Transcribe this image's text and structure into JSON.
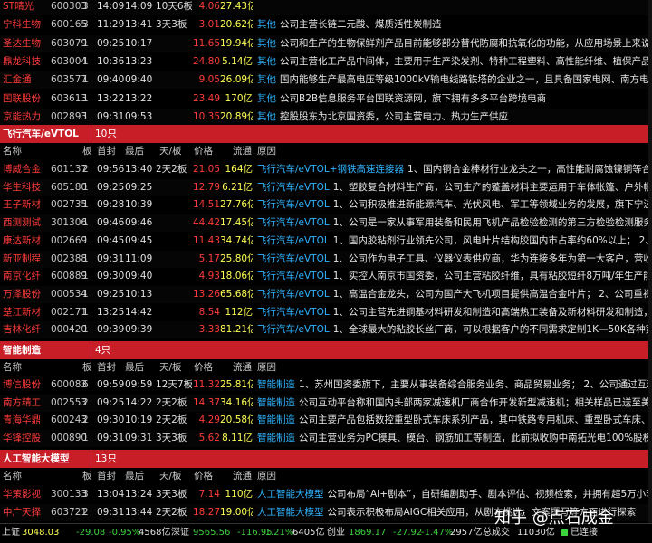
{
  "columns": {
    "name": "名称",
    "board": "板",
    "first": "首封",
    "last": "最后",
    "days": "天/板",
    "price": "价格",
    "flow": "流通",
    "reason": "原因"
  },
  "block1": {
    "rows": [
      {
        "name": "ST晴光",
        "code": "600303",
        "board": "3",
        "first": "14:09",
        "last": "14:09",
        "days": "10天6板",
        "price": "4.06",
        "flow": "27.43亿",
        "tag": "",
        "text": ""
      },
      {
        "name": "宁科生物",
        "code": "600165",
        "board": "3",
        "first": "11:29",
        "last": "13:41",
        "days": "3天3板",
        "price": "3.01",
        "flow": "20.62亿",
        "tag": "其他",
        "text": "公司主营长链二元酸、煤质活性炭制造"
      },
      {
        "name": "圣达生物",
        "code": "603079",
        "board": "1",
        "first": "09:25",
        "last": "10:17",
        "days": "",
        "price": "11.65",
        "flow": "19.94亿",
        "tag": "其他",
        "text": "公司和生产的生物保鲜剂产品目前能够部分替代防腐和抗氧化的功能，从应用场景上来说，能够提"
      },
      {
        "name": "鼎龙科技",
        "code": "603004",
        "board": "1",
        "first": "10:36",
        "last": "13:23",
        "days": "",
        "price": "24.80",
        "flow": "5.14亿",
        "tag": "其他",
        "text": "公司主营化工产品中间体，主要用于生产染发剂、特种工程塑料、高性能纤维、植保产品等，在化"
      },
      {
        "name": "汇金通",
        "code": "603577",
        "board": "1",
        "first": "09:40",
        "last": "09:40",
        "days": "",
        "price": "9.05",
        "flow": "26.09亿",
        "tag": "其他",
        "text": "国内能够生产最高电压等级1000kV输电线路铁塔的企业之一，且具备国家电网、南方电网等公"
      },
      {
        "name": "国联股份",
        "code": "603613",
        "board": "1",
        "first": "13:22",
        "last": "13:22",
        "days": "",
        "price": "23.49",
        "flow": "170亿",
        "tag": "其他",
        "text": "公司B2B信息服务平台国联资源网，旗下拥有多多平台跨境电商"
      },
      {
        "name": "京能热力",
        "code": "002893",
        "board": "1",
        "first": "09:31",
        "last": "09:53",
        "days": "",
        "price": "10.35",
        "flow": "20.89亿",
        "tag": "其他",
        "text": "控股股东为北京国资委，公司主营电力、热力生产供应"
      }
    ]
  },
  "section_flying": {
    "name": "飞行汽车/eVTOL",
    "count": "10只"
  },
  "block2": {
    "rows": [
      {
        "name": "博威合金",
        "code": "601137",
        "board": "2",
        "first": "09:56",
        "last": "13:40",
        "days": "2天2板",
        "price": "21.05",
        "flow": "164亿",
        "tag": "飞行汽车/eVTOL+钢铁高速连接器",
        "text": "1、国内铜合金棒材行业龙头之一，高性能耐腐蚀镍铜等合金材料"
      },
      {
        "name": "华生科技",
        "code": "605180",
        "board": "1",
        "first": "09:25",
        "last": "09:25",
        "days": "",
        "price": "12.79",
        "flow": "6.21亿",
        "tag": "飞行汽车/eVTOL",
        "text": "1、塑胶复合材料生产商，公司生产的蓬盖材料主要运用于车体帐篷、户外帐篷、箱包"
      },
      {
        "name": "王子新材",
        "code": "002735",
        "board": "1",
        "first": "09:28",
        "last": "10:39",
        "days": "",
        "price": "14.51",
        "flow": "27.76亿",
        "tag": "飞行汽车/eVTOL",
        "text": "1、公司积极推进新能源汽车、光伏风电、军工等领域业务的发展，旗下宁波新容与"
      },
      {
        "name": "西测测试",
        "code": "301306",
        "board": "1",
        "first": "09:46",
        "last": "09:46",
        "days": "",
        "price": "44.42",
        "flow": "17.45亿",
        "tag": "飞行汽车/eVTOL",
        "text": "1、公司是一家从事军用装备和民用飞机产品检验检测的第三方检验检测服务机构，有"
      },
      {
        "name": "康达新材",
        "code": "002669",
        "board": "1",
        "first": "09:45",
        "last": "09:45",
        "days": "",
        "price": "11.43",
        "flow": "34.74亿",
        "tag": "飞行汽车/eVTOL",
        "text": "1、国内胶粘剂行业领先公司，风电叶片结构胶国内市占率约60%以上； 2、公司筹建自"
      },
      {
        "name": "新亚制程",
        "code": "002388",
        "board": "1",
        "first": "09:31",
        "last": "11:09",
        "days": "",
        "price": "5.17",
        "flow": "25.80亿",
        "tag": "飞行汽车/eVTOL",
        "text": "1、公司作为电子工具、仪器仪表供应商，华为连接多年为第一大客户，营收占比多"
      },
      {
        "name": "南京化纤",
        "code": "600889",
        "board": "1",
        "first": "09:30",
        "last": "09:40",
        "days": "",
        "price": "4.93",
        "flow": "18.06亿",
        "tag": "飞行汽车/eVTOL",
        "text": "1、实控人南京市国资委，公司主营粘胶纤维，具有粘胶短纤8万吨/年生产能力； 2"
      },
      {
        "name": "万泽股份",
        "code": "000534",
        "board": "1",
        "first": "09:25",
        "last": "10:13",
        "days": "",
        "price": "13.26",
        "flow": "65.68亿",
        "tag": "飞行汽车/eVTOL",
        "text": "1、高温合金龙头，公司为国产大飞机项目提供高温合金叶片； 2、公司重视技术研"
      },
      {
        "name": "楚江新材",
        "code": "002171",
        "board": "1",
        "first": "13:25",
        "last": "14:42",
        "days": "",
        "price": "8.54",
        "flow": "112亿",
        "tag": "飞行汽车/eVTOL",
        "text": "1、公司主营先进铜基材料研发和制造和高端热工装备及新材料研发和制造，拥有军工"
      },
      {
        "name": "吉林化纤",
        "code": "000420",
        "board": "1",
        "first": "09:39",
        "last": "09:39",
        "days": "",
        "price": "3.33",
        "flow": "81.21亿",
        "tag": "飞行汽车/eVTOL",
        "text": "1、全球最大的粘胶长丝厂商，可以根据客户的不同需求定制1K—50K各种宽幅碳纤维丝束"
      }
    ]
  },
  "section_smart": {
    "name": "智能制造",
    "count": "4只"
  },
  "block3": {
    "rows": [
      {
        "name": "博信股份",
        "code": "600083",
        "board": "6",
        "first": "09:59",
        "last": "09:59",
        "days": "12天7板",
        "price": "11.32",
        "flow": "25.81亿",
        "tag": "智能制造",
        "text": "1、苏州国资委旗下，主要从事装备综合服务业务、商品贸易业务； 2、公司通过互动易平台表示"
      },
      {
        "name": "南方精工",
        "code": "002553",
        "board": "2",
        "first": "09:25",
        "last": "14:22",
        "days": "2天2板",
        "price": "14.37",
        "flow": "34.16亿",
        "tag": "智能制造",
        "text": "公司互动平台称和国内头部两家减速机厂商合作开发新型减速机；相关样品已送至美国特斯拉"
      },
      {
        "name": "青海华鼎",
        "code": "600243",
        "board": "2",
        "first": "09:30",
        "last": "10:19",
        "days": "2天2板",
        "price": "4.29",
        "flow": "20.58亿",
        "tag": "智能制造",
        "text": "公司主要产品包括数控重型卧式车床系列产品，其中铁路专用机床、重型卧式车床、轧辊车床"
      },
      {
        "name": "华锋控股",
        "code": "000890",
        "board": "1",
        "first": "09:31",
        "last": "09:31",
        "days": "3天3板",
        "price": "5.62",
        "flow": "8.11亿",
        "tag": "智能制造",
        "text": "公司主营业务为PC模具、模台、钢筋加工等制造，此前拟收购中南拓光电100%股权，标的主营"
      }
    ]
  },
  "section_ai": {
    "name": "人工智能大模型",
    "count": "13只"
  },
  "block4": {
    "rows": [
      {
        "name": "华策影视",
        "code": "300133",
        "board": "3",
        "first": "13:04",
        "last": "13:24",
        "days": "3天3板",
        "price": "7.14",
        "flow": "110亿",
        "tag": "人工智能大模型",
        "text": "公司布局“AI+剧本”，自研编剧助手、剧本评估、视频检索，并拥有超5万小时音视频"
      },
      {
        "name": "中广天择",
        "code": "603721",
        "board": "2",
        "first": "09:31",
        "last": "13:44",
        "days": "2天2板",
        "price": "18.27",
        "flow": "19.00亿",
        "tag": "人工智能大模型",
        "text": "公司表示积极布局AIGC相关应用，从剧本挑选、文案撰写等方面进行探索"
      }
    ]
  },
  "status": {
    "sh_label": "上证",
    "sh_val": "3048.03",
    "sh_chg": "-29.08",
    "sh_pct": "-0.95%",
    "sh_amt": "4568亿",
    "sz_label": "深证",
    "sz_val": "9565.56",
    "sz_chg": "-116.95",
    "sz_pct": "-1.21%",
    "sz_amt": "6405亿",
    "cy_label": "创业",
    "cy_val": "1869.17",
    "cy_chg": "-27.92",
    "cy_pct": "-1.47%",
    "cy_amt": "2957亿",
    "total_label": "总成交",
    "total_val": "11030亿",
    "conn": "已连接"
  },
  "watermark": "知乎 @点石成金"
}
